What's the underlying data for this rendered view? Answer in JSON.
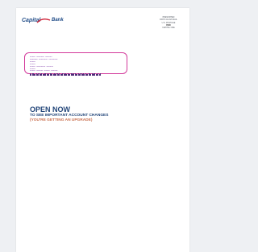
{
  "brand": {
    "name_part1": "Capital",
    "name_part2": "One",
    "name_part3": "Bank",
    "primary_color": "#1f4b87",
    "swoosh_color": "#cf2035"
  },
  "postage": {
    "lines": [
      "PRESORTED",
      "FIRST-CLASS MAIL",
      "U.S. POSTAGE",
      "PAID",
      "CAPITAL ONE"
    ]
  },
  "address_window": {
    "border_color": "#d33a9b",
    "lines": [
      "##### ####### ######",
      "0000000 ######## ########",
      "#####",
      "#####",
      "##### ######## ######",
      "#####",
      "##### ###### ##### ######"
    ]
  },
  "headline": {
    "line1": "OPEN NOW",
    "line2": "TO SEE IMPORTANT ACCOUNT CHANGES",
    "line3": "(YOU'RE GETTING AN UPGRADE)"
  }
}
